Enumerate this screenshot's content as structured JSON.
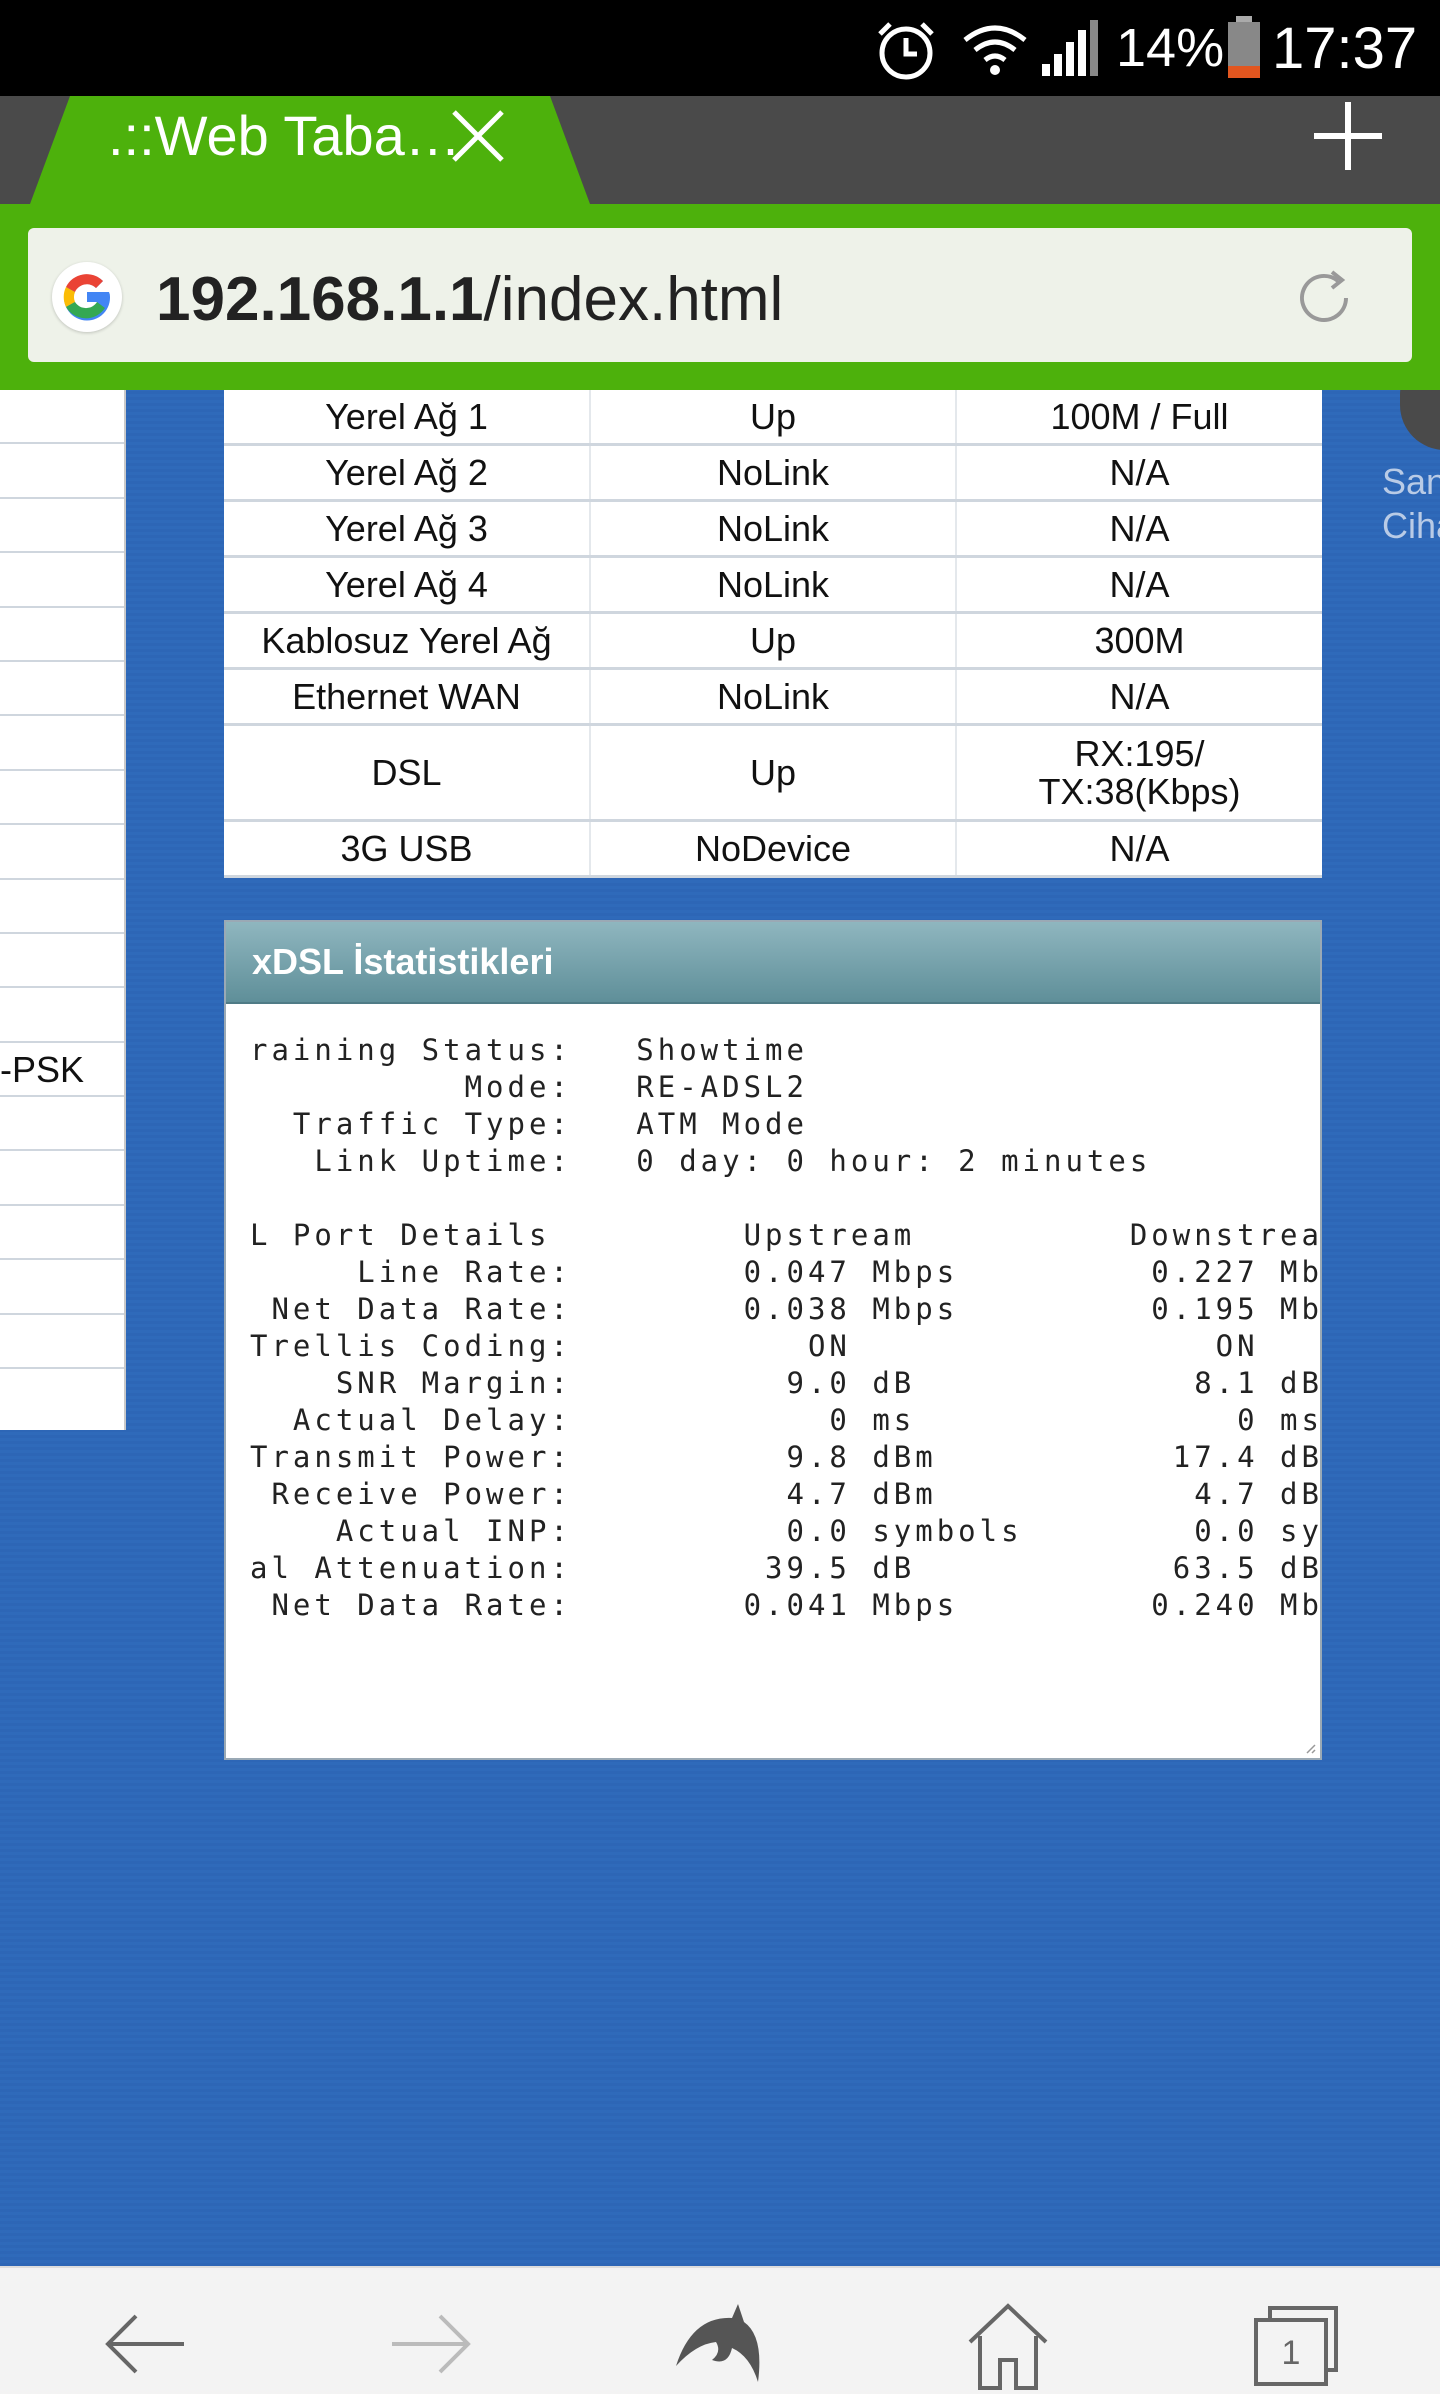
{
  "status_bar": {
    "icons": [
      "alarm-icon",
      "wifi-icon",
      "signal-icon",
      "battery-icon"
    ],
    "battery": "14%",
    "time": "17:37"
  },
  "browser": {
    "tab_title": ".::Web Taba…",
    "url_host": "192.168.1.1",
    "url_path": "/index.html",
    "accent_color": "#4db10c"
  },
  "sidebar": {
    "visible_fragment": "-PSK"
  },
  "right_edge_fragment": {
    "line1": "San",
    "line2": "Cihaz"
  },
  "ports": [
    {
      "name": "Yerel Ağ 1",
      "status": "Up",
      "rate": "100M / Full"
    },
    {
      "name": "Yerel Ağ 2",
      "status": "NoLink",
      "rate": "N/A"
    },
    {
      "name": "Yerel Ağ 3",
      "status": "NoLink",
      "rate": "N/A"
    },
    {
      "name": "Yerel Ağ 4",
      "status": "NoLink",
      "rate": "N/A"
    },
    {
      "name": "Kablosuz Yerel Ağ",
      "status": "Up",
      "rate": "300M"
    },
    {
      "name": "Ethernet WAN",
      "status": "NoLink",
      "rate": "N/A"
    },
    {
      "name": "DSL",
      "status": "Up",
      "rate": "RX:195/\nTX:38(Kbps)"
    },
    {
      "name": "3G USB",
      "status": "NoDevice",
      "rate": "N/A"
    }
  ],
  "xdsl": {
    "title": "xDSL İstatistikleri",
    "text": "raining Status:   Showtime\n          Mode:   RE-ADSL2\n  Traffic Type:   ATM Mode\n   Link Uptime:   0 day: 0 hour: 2 minutes\n\nL Port Details         Upstream          Downstream\n     Line Rate:        0.047 Mbps         0.227 Mbps\n Net Data Rate:        0.038 Mbps         0.195 Mbps\nTrellis Coding:           ON                 ON\n    SNR Margin:          9.0 dB             8.1 dB\n  Actual Delay:            0 ms               0 ms\nTransmit Power:          9.8 dBm           17.4 dBm\n Receive Power:          4.7 dBm            4.7 dBm\n    Actual INP:          0.0 symbols        0.0 symbols\nal Attenuation:         39.5 dB            63.5 dB\n Net Data Rate:        0.041 Mbps         0.240 Mbps"
  },
  "nav_bar": {
    "icons": [
      "back-icon",
      "forward-icon",
      "dolphin-icon",
      "home-icon",
      "tabs-icon"
    ],
    "tabs_count": "1"
  }
}
